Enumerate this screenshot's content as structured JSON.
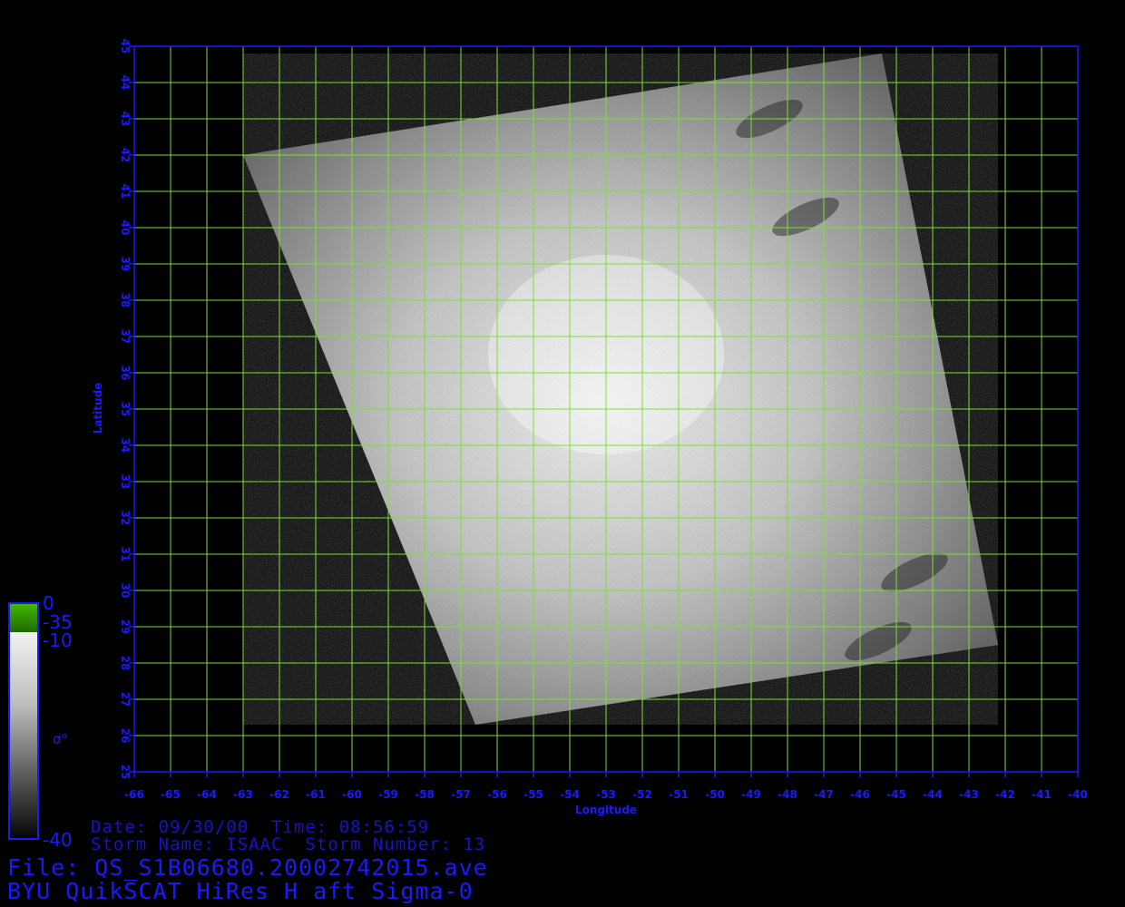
{
  "axes": {
    "xlabel": "Longitude",
    "ylabel": "Latitude",
    "xlim": [
      -66,
      -40
    ],
    "ylim": [
      25,
      45
    ],
    "xticks": [
      -66,
      -65,
      -64,
      -63,
      -62,
      -61,
      -60,
      -59,
      -58,
      -57,
      -56,
      -55,
      -54,
      -53,
      -52,
      -51,
      -50,
      -49,
      -48,
      -47,
      -46,
      -45,
      -44,
      -43,
      -42,
      -41,
      -40
    ],
    "yticks": [
      25,
      26,
      27,
      28,
      29,
      30,
      31,
      32,
      33,
      34,
      35,
      36,
      37,
      38,
      39,
      40,
      41,
      42,
      43,
      44,
      45
    ]
  },
  "swath": {
    "corners_lonlat": [
      [
        -63.0,
        42.0
      ],
      [
        -45.4,
        44.8
      ],
      [
        -42.2,
        28.5
      ],
      [
        -56.6,
        26.3
      ]
    ],
    "bright_center_lonlat": [
      -53.0,
      36.5
    ],
    "dark_features_lonlat": [
      [
        -48.5,
        43.0
      ],
      [
        -47.5,
        40.3
      ],
      [
        -45.5,
        28.6
      ],
      [
        -44.5,
        30.5
      ]
    ]
  },
  "colorbar": {
    "ticks": [
      "0",
      "-35",
      "-10",
      "-40"
    ],
    "symbol": "σ°",
    "colors": {
      "top": "#2aa000",
      "light": "#f0f0f0",
      "dark": "#000000"
    }
  },
  "info": {
    "date_line": "Date: 09/30/00  Time: 08:56:59",
    "storm_line": "Storm Name: ISAAC  Storm Number: 13",
    "file_line": "File: QS_S1B06680.20002742015.ave",
    "title_line": "BYU QuikSCAT HiRes H aft Sigma-0"
  },
  "colors": {
    "frame": "#1a1aff",
    "grid": "#7fdc3c",
    "text": "#1a1aff",
    "background": "#000000"
  }
}
